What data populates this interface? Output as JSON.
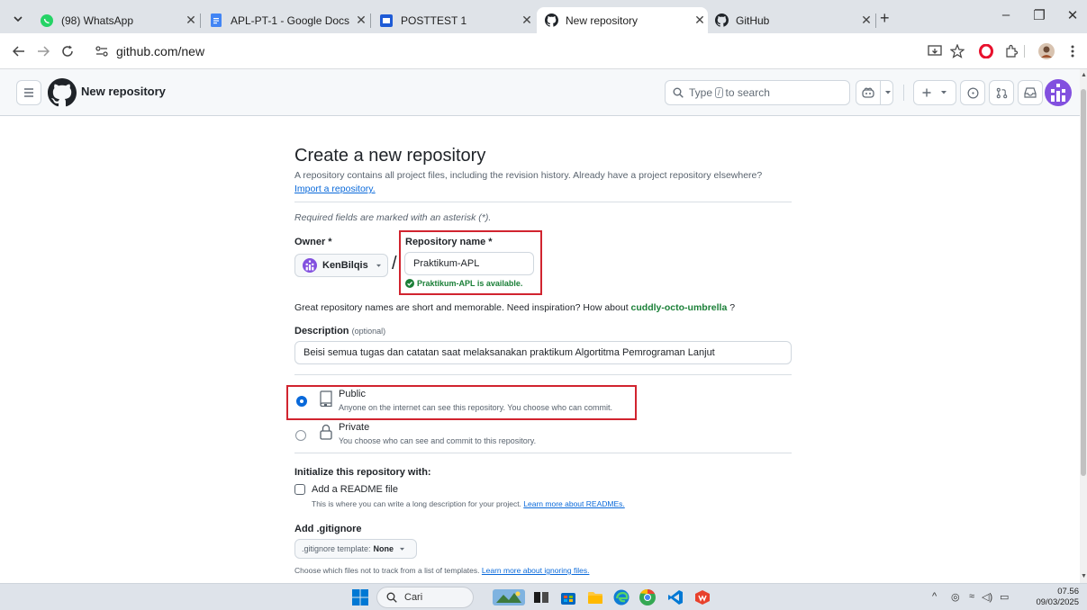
{
  "browser": {
    "tabs": [
      {
        "title": "(98) WhatsApp",
        "icon": "whatsapp-icon"
      },
      {
        "title": "APL-PT-1 - Google Docs",
        "icon": "google-docs-icon"
      },
      {
        "title": "POSTTEST 1",
        "icon": "posttest-icon"
      },
      {
        "title": "New repository",
        "icon": "github-icon",
        "active": true
      },
      {
        "title": "GitHub",
        "icon": "github-icon"
      }
    ],
    "new_tab": "+",
    "window_controls": {
      "minimize": "–",
      "restore": "❐",
      "close": "✕"
    },
    "url": "github.com/new"
  },
  "header": {
    "title": "New repository",
    "search_prefix": "Type",
    "search_key": "/",
    "search_suffix": "to search"
  },
  "form": {
    "heading": "Create a new repository",
    "subtitle": "A repository contains all project files, including the revision history. Already have a project repository elsewhere?",
    "import_link": "Import a repository.",
    "required_note": "Required fields are marked with an asterisk (*).",
    "owner_label": "Owner *",
    "owner_value": "KenBilqis",
    "slash": "/",
    "repo_label": "Repository name *",
    "repo_value": "Praktikum-APL",
    "available": "Praktikum-APL is available.",
    "inspiration_prefix": "Great repository names are short and memorable. Need inspiration? How about",
    "inspiration_name": "cuddly-octo-umbrella",
    "inspiration_suffix": "?",
    "description_label": "Description",
    "description_optional": "(optional)",
    "description_value": "Beisi semua tugas dan catatan saat melaksanakan praktikum Algortitma Pemrograman Lanjut",
    "visibility": {
      "public_title": "Public",
      "public_desc": "Anyone on the internet can see this repository. You choose who can commit.",
      "private_title": "Private",
      "private_desc": "You choose who can see and commit to this repository.",
      "selected": "public"
    },
    "init_label": "Initialize this repository with:",
    "readme_label": "Add a README file",
    "readme_desc": "This is where you can write a long description for your project.",
    "readme_link": "Learn more about READMEs.",
    "gitignore_label": "Add .gitignore",
    "gitignore_button": ".gitignore template:",
    "gitignore_value": "None",
    "gitignore_desc": "Choose which files not to track from a list of templates.",
    "gitignore_link": "Learn more about ignoring files."
  },
  "taskbar": {
    "search": "Cari",
    "time": "07.56",
    "date": "09/03/2025"
  },
  "colors": {
    "accent_blue": "#0969da",
    "success_green": "#1a7f37",
    "highlight_red": "#d1242f"
  }
}
